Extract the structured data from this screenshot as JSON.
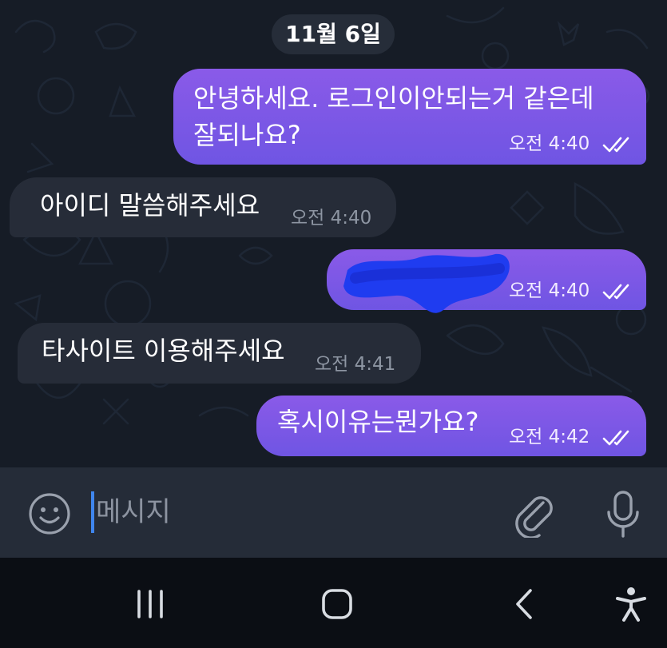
{
  "date_separator": "11월 6일",
  "messages": [
    {
      "direction": "out",
      "lines": [
        "안녕하세요. 로그인이안되는거 같은데",
        "잘되나요?"
      ],
      "time": "오전 4:40",
      "status": "read"
    },
    {
      "direction": "in",
      "lines": [
        "아이디 말씀해주세요"
      ],
      "time": "오전 4:40"
    },
    {
      "direction": "out",
      "lines": [],
      "time": "오전 4:40",
      "status": "read",
      "redacted": true
    },
    {
      "direction": "in",
      "lines": [
        "타사이트 이용해주세요"
      ],
      "time": "오전 4:41"
    },
    {
      "direction": "out",
      "lines": [
        "혹시이유는뭔가요?"
      ],
      "time": "오전 4:42",
      "status": "read"
    }
  ],
  "composer": {
    "placeholder": "메시지",
    "icons": [
      "emoji-icon",
      "attach-icon",
      "microphone-icon"
    ]
  },
  "navigation": {
    "icons": [
      "recent-apps-icon",
      "home-icon",
      "back-icon",
      "accessibility-icon"
    ]
  },
  "colors": {
    "outgoing_bubble": "#7a57e6",
    "incoming_bubble": "#262c38",
    "chat_background": "#161c26",
    "redaction_scribble": "#1f3cf0"
  }
}
